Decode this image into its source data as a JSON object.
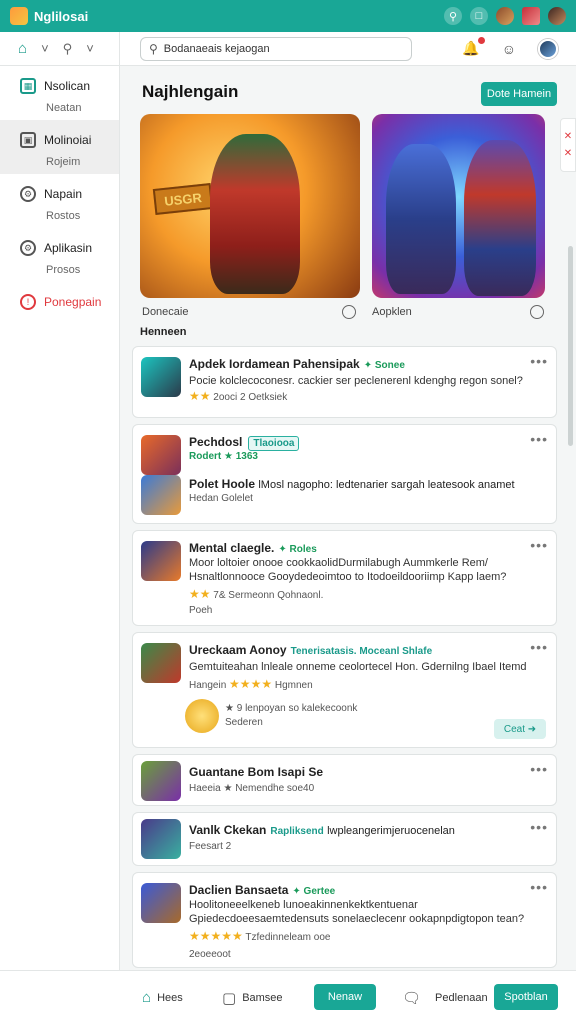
{
  "app": {
    "brand": "Nglilosai"
  },
  "search": {
    "value": "Bodanaeais kejaogan"
  },
  "sidebar": {
    "items": [
      {
        "label": "Nsolican",
        "sub": "Neatan",
        "icon": "window-icon"
      },
      {
        "label": "Molinoiai",
        "sub": "Rojeim",
        "icon": "store-icon"
      },
      {
        "label": "Napain",
        "sub": "Rostos",
        "icon": "gear-icon"
      },
      {
        "label": "Aplikasin",
        "sub": "Prosos",
        "icon": "settings-icon"
      },
      {
        "label": "Ponegpain",
        "sub": "",
        "icon": "alert-icon"
      }
    ]
  },
  "main": {
    "title": "Najhlengain",
    "top_button": "Dote Hamein",
    "banner1_sign": "USGR",
    "banner_captions": [
      "Donecaie",
      "Aopklen"
    ],
    "section_label": "Henneen"
  },
  "cards": [
    {
      "title": "Apdek Iordamean Pahensipak",
      "tag": "✦ Sonee",
      "line1": "Pocie kolclecoconesr. cackier ser peclenerenl kdenghg regon sonel?",
      "line2_stars": "★★",
      "line2": "2ooci 2 Oetksiek"
    },
    {
      "title": "Pechdosl",
      "chip": "Tlaoiooa",
      "line1": "Rodert ★ 1363",
      "line2_title": "Polet Hoole",
      "line2": "lMosl nagopho: ledtenarier sargah leatesook anamet",
      "line3": "Hedan Golelet"
    },
    {
      "title": "Mental claegle.",
      "tag": "✦ Roles",
      "line1": "Moor loltoier onooe cookkaolidDurmilabugh Aummkerle Rem/",
      "line2": "Hsnaltlonnooce Gooydedeoimtoo to Itodoeildooriimp Kapp laem?",
      "line3_stars": "★★",
      "line3": "7& Sermeonn Qohnaonl.",
      "line4": "Poeh"
    },
    {
      "title": "Ureckaam Aonoy",
      "tag": "Tenerisatasis. Moceanl Shlafe",
      "line1": "Gemtuiteahan lnleale onneme ceolortecel Hon. Gdernilng Ibael Itemd",
      "line2_pre": "Hangein",
      "line2_stars": "★★★★",
      "line2": "Hgmnen",
      "line3": "★ 9 lenpoyan so kalekecoonk",
      "line4": "Sederen",
      "button": "Ceat ➜"
    },
    {
      "title": "Guantane Bom Isapi Se",
      "line1": "Haeeia ★ Nemendhe soe40"
    },
    {
      "title": "Vanlk Ckekan",
      "tag": "Rapliksend",
      "line1": "lwpleangerimjeruocenelan",
      "line2": "Feesart 2"
    },
    {
      "title": "Daclien Bansaeta",
      "tag": "✦ Gertee",
      "line1": "Hoolitoneeelkeneb lunoeakinnenkektkentuenar",
      "line2": "Gpiedecdoeesaemtedensuts sonelaeclecenr ookapnpdigtopon tean?",
      "line3_stars": "★★★★★",
      "line3": "Tzfedinneleam ooe",
      "line4": "2eoeeoot"
    }
  ],
  "bottombar": {
    "items": [
      "Hees",
      "Bamsee",
      "Pedlenaan"
    ],
    "primary_button": "Nenaw",
    "right_button": "Spotblan"
  },
  "colors": {
    "accent": "#19a796",
    "alert": "#e0393e",
    "star": "#f2b01e"
  }
}
